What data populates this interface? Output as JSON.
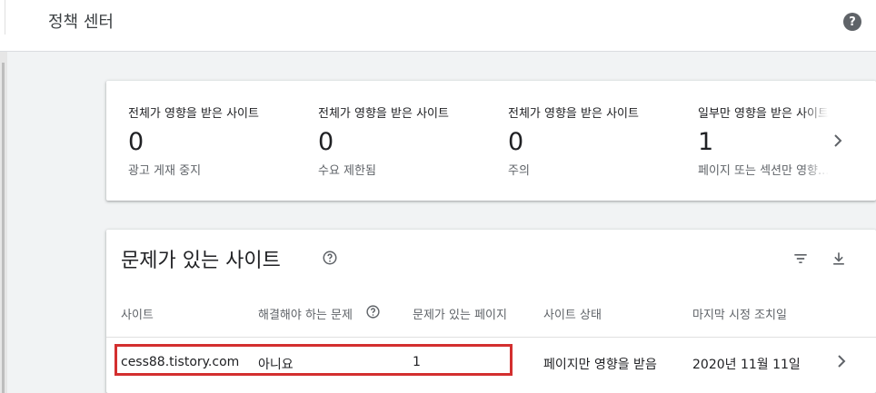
{
  "header": {
    "title": "정책 센터",
    "help_symbol": "?"
  },
  "summary_cards": [
    {
      "heading": "전체가 영향을 받은 사이트",
      "value": "0",
      "caption": "광고 게재 중지"
    },
    {
      "heading": "전체가 영향을 받은 사이트",
      "value": "0",
      "caption": "수요 제한됨"
    },
    {
      "heading": "전체가 영향을 받은 사이트",
      "value": "0",
      "caption": "주의"
    },
    {
      "heading": "일부만 영향을 받은 사이트",
      "value": "1",
      "caption": "페이지 또는 섹션만 영향..."
    }
  ],
  "issues_section": {
    "title": "문제가 있는 사이트",
    "columns": {
      "site": "사이트",
      "issue_to_fix": "해결해야 하는 문제",
      "pages_with_issues": "문제가 있는 페이지",
      "site_status": "사이트 상태",
      "last_enforcement": "마지막 시정 조치일"
    },
    "rows": [
      {
        "site": "cess88.tistory.com",
        "issue_to_fix": "아니요",
        "pages_with_issues": "1",
        "site_status": "페이지만 영향을 받음",
        "last_enforcement": "2020년 11월 11일"
      }
    ]
  },
  "icons": {
    "help": "help-circle-icon",
    "next": "chevron-right-icon",
    "filter": "filter-icon",
    "download": "download-icon",
    "info": "help-outline-icon"
  },
  "colors": {
    "highlight_border": "#d32f2f",
    "background": "#f1f3f4",
    "secondary_text": "#5f6368"
  }
}
